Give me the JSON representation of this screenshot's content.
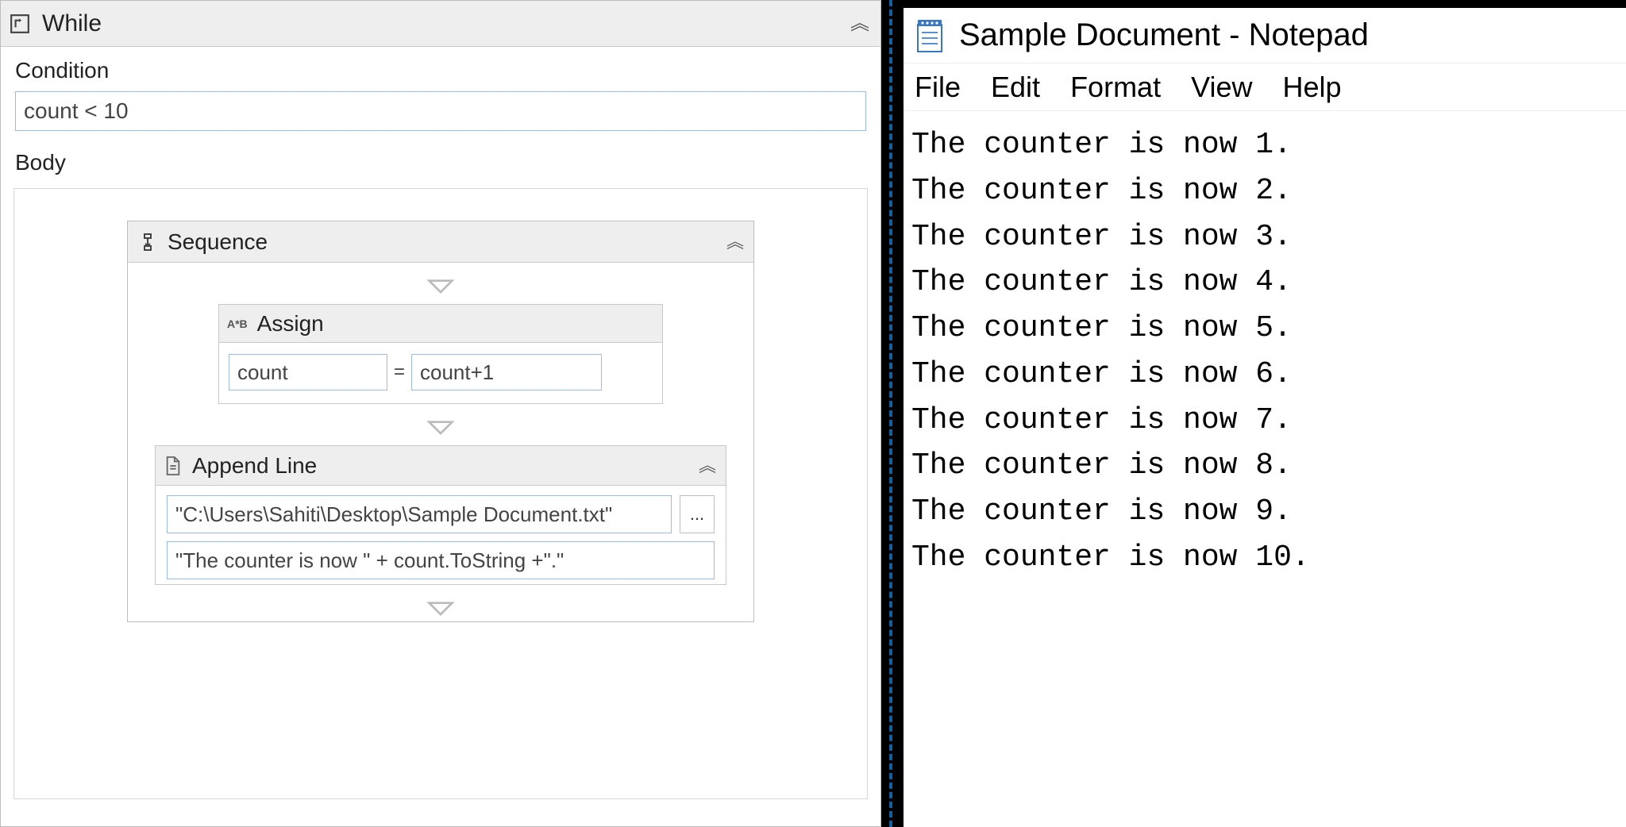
{
  "while": {
    "title": "While",
    "condition_label": "Condition",
    "condition_value": "count < 10",
    "body_label": "Body"
  },
  "sequence": {
    "title": "Sequence"
  },
  "assign": {
    "title": "Assign",
    "icon_text": "A*B",
    "var": "count",
    "eq": "=",
    "expr": "count+1"
  },
  "append_line": {
    "title": "Append Line",
    "file_path": "\"C:\\Users\\Sahiti\\Desktop\\Sample Document.txt\"",
    "browse_label": "...",
    "text_expr": "\"The counter is now \" + count.ToString +\".\""
  },
  "notepad": {
    "title": "Sample Document - Notepad",
    "menu": [
      "File",
      "Edit",
      "Format",
      "View",
      "Help"
    ],
    "lines": [
      "The counter is now 1.",
      "The counter is now 2.",
      "The counter is now 3.",
      "The counter is now 4.",
      "The counter is now 5.",
      "The counter is now 6.",
      "The counter is now 7.",
      "The counter is now 8.",
      "The counter is now 9.",
      "The counter is now 10."
    ]
  }
}
